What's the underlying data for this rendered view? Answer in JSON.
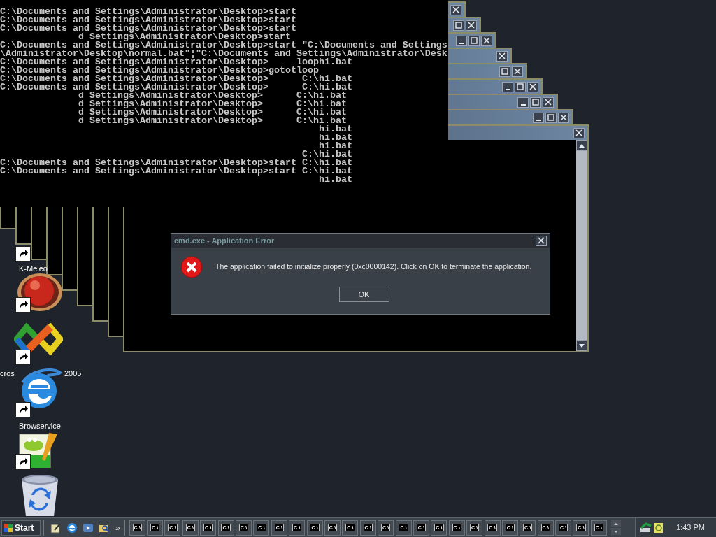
{
  "console": {
    "lines": [
      "C:\\Documents and Settings\\Administrator\\Desktop>start",
      "C:\\Documents and Settings\\Administrator\\Desktop>start",
      "C:\\Documents and Settings\\Administrator\\Desktop>start",
      "              d Settings\\Administrator\\Desktop>start",
      "C:\\Documents and Settings\\Administrator\\Desktop>start \"C:\\Documents and Settings",
      "\\Administrator\\Desktop\\normal.bat\"¦\"C:\\Documents and Settings\\Administrator\\Desk",
      "C:\\Documents and Settings\\Administrator\\Desktop>     loophi.bat",
      "C:\\Documents and Settings\\Administrator\\Desktop>gototloop",
      "C:\\Documents and Settings\\Administrator\\Desktop>      C:\\hi.bat",
      "C:\\Documents and Settings\\Administrator\\Desktop>      C:\\hi.bat",
      "              d Settings\\Administrator\\Desktop>      C:\\hi.bat",
      "              d Settings\\Administrator\\Desktop>      C:\\hi.bat",
      "              d Settings\\Administrator\\Desktop>      C:\\hi.bat",
      "              d Settings\\Administrator\\Desktop>      C:\\hi.bat",
      "                                                         hi.bat",
      "                                                         hi.bat",
      "                                                         hi.bat",
      "                                                      C:\\hi.bat",
      "C:\\Documents and Settings\\Administrator\\Desktop>start C:\\hi.bat",
      "C:\\Documents and Settings\\Administrator\\Desktop>start C:\\hi.bat",
      "                                                         hi.bat"
    ]
  },
  "cascade_windows": [
    {
      "controls": [
        {
          "kind": "close"
        }
      ]
    },
    {
      "controls": [
        {
          "kind": "maximize"
        },
        {
          "kind": "close"
        }
      ]
    },
    {
      "controls": [
        {
          "kind": "minimize"
        },
        {
          "kind": "maximize"
        },
        {
          "kind": "close"
        }
      ]
    },
    {
      "controls": [
        {
          "kind": "close"
        }
      ]
    },
    {
      "controls": [
        {
          "kind": "maximize"
        },
        {
          "kind": "close"
        }
      ]
    },
    {
      "controls": [
        {
          "kind": "minimize"
        },
        {
          "kind": "maximize"
        },
        {
          "kind": "close"
        }
      ]
    },
    {
      "controls": [
        {
          "kind": "minimize"
        },
        {
          "kind": "maximize"
        },
        {
          "kind": "close"
        }
      ]
    },
    {
      "controls": [
        {
          "kind": "minimize"
        },
        {
          "kind": "maximize"
        },
        {
          "kind": "close"
        }
      ]
    },
    {
      "controls": [
        {
          "kind": "close"
        }
      ]
    }
  ],
  "dialog": {
    "title": "cmd.exe - Application Error",
    "message": "The application failed to initialize properly (0xc0000142). Click on OK to terminate the application.",
    "button": "OK"
  },
  "desktop_icons": [
    {
      "shortcut": true,
      "label": "K-Meleo"
    },
    {
      "kind": "ball",
      "shortcut": true
    },
    {
      "kind": "knot",
      "shortcut": true,
      "label_parts": [
        "cros",
        "2005"
      ]
    },
    {
      "kind": "e-globe",
      "shortcut": true,
      "label": "Browservice"
    },
    {
      "kind": "notepad",
      "shortcut": true
    },
    {
      "kind": "bin",
      "shortcut": false
    }
  ],
  "taskbar": {
    "start": "Start",
    "quick_launch": [
      {
        "kind": "desktop"
      },
      {
        "kind": "e-globe"
      },
      {
        "kind": "media"
      },
      {
        "kind": "folder-search"
      }
    ],
    "more": "»",
    "tasks": [
      {
        "label": "C:\\"
      },
      {
        "label": "C:\\"
      },
      {
        "label": "C:\\"
      },
      {
        "label": "C:\\"
      },
      {
        "label": "C:\\"
      },
      {
        "label": "C:\\"
      },
      {
        "label": "C:\\"
      },
      {
        "label": "C:\\"
      },
      {
        "label": "C:\\"
      },
      {
        "label": "C:\\"
      },
      {
        "label": "C:\\"
      },
      {
        "label": "C:\\"
      },
      {
        "label": "C:\\"
      },
      {
        "label": "C:\\"
      },
      {
        "label": "C:\\"
      },
      {
        "label": "C:\\"
      },
      {
        "label": "C:\\"
      },
      {
        "label": "C:\\"
      },
      {
        "label": "C:\\"
      },
      {
        "label": "C:\\"
      },
      {
        "label": "C:\\"
      },
      {
        "label": "C:\\"
      },
      {
        "label": "C:\\"
      },
      {
        "label": "C:\\"
      },
      {
        "label": "C:\\"
      },
      {
        "label": "C:\\"
      },
      {
        "label": "C:\\"
      }
    ],
    "tray": [
      {
        "kind": "network"
      },
      {
        "kind": "note"
      }
    ],
    "clock": "1:43 PM"
  }
}
